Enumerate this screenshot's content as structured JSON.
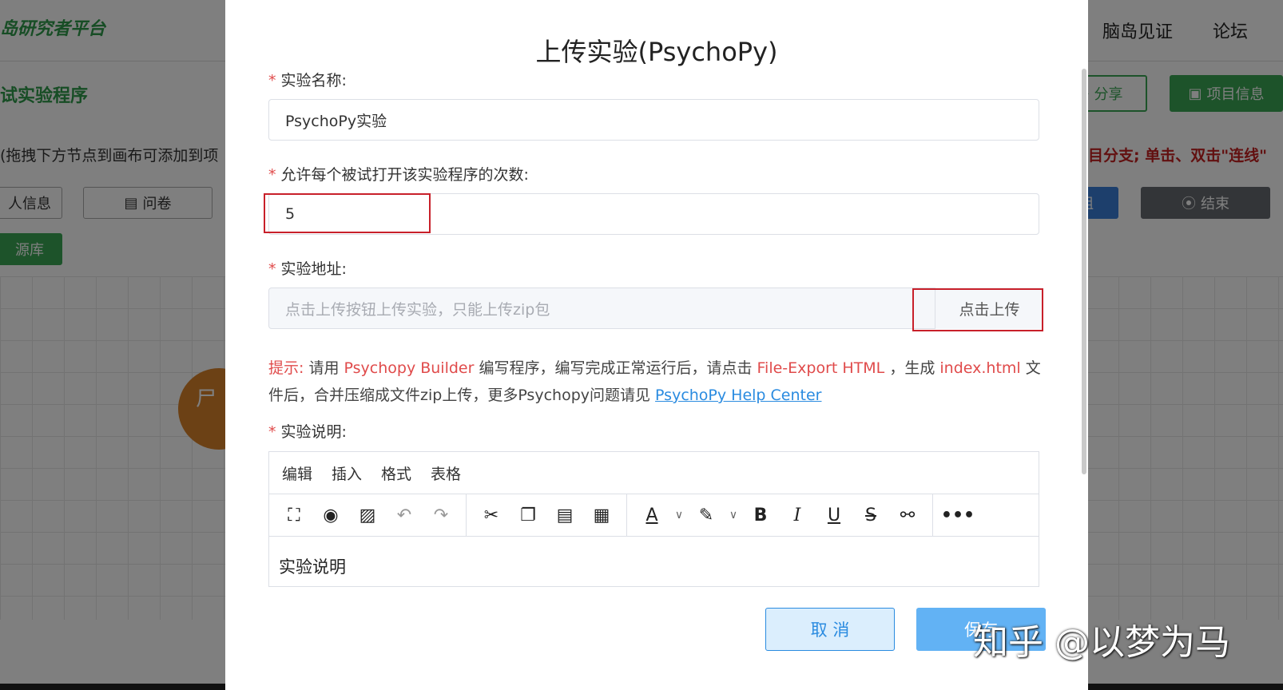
{
  "background_app": {
    "brand": "岛研究者平台",
    "nav": [
      "脑岛见证",
      "论坛"
    ],
    "section_title": "试实验程序",
    "hint": "(拖拽下方节点到画布可添加到项",
    "hint_right": "目分支; 单击、双击\"连线\"",
    "buttons": {
      "share": "分享",
      "project_info": "项目信息",
      "personal_info": "人信息",
      "questionnaire": "问卷",
      "resource_lib": "源库",
      "blue_partial": "组",
      "end": "结束"
    },
    "node_label": "尸"
  },
  "modal": {
    "title": "上传实验(PsychoPy)",
    "fields": {
      "name": {
        "label": "实验名称:",
        "value": "PsychoPy实验"
      },
      "attempts": {
        "label": "允许每个被试打开该实验程序的次数:",
        "value": "5"
      },
      "address": {
        "label": "实验地址:",
        "placeholder": "点击上传按钮上传实验，只能上传zip包",
        "upload_label": "点击上传"
      },
      "description": {
        "label": "实验说明:"
      }
    },
    "required_mark": "*",
    "tip": {
      "prefix": "提示:",
      "t1": " 请用 ",
      "psychopy_builder": "Psychopy Builder",
      "t2": " 编写程序，编写完成正常运行后，请点击 ",
      "file_export": "File-Export HTML",
      "t3": " ，生成 ",
      "index_html": "index.html",
      "t4": " 文件后，合并压缩成文件zip上传，更多Psychopy问题请见 ",
      "help_link": "PsychoPy Help Center"
    },
    "editor": {
      "menus": [
        "编辑",
        "插入",
        "格式",
        "表格"
      ],
      "content": "实验说明"
    },
    "buttons": {
      "cancel": "取 消",
      "save": "保存"
    }
  },
  "watermark": "知乎 @以梦为马",
  "colors": {
    "primary": "#2a8be0",
    "required": "#e04b4b",
    "highlight_box": "#c8202a",
    "brand_green": "#2f9a4a"
  }
}
